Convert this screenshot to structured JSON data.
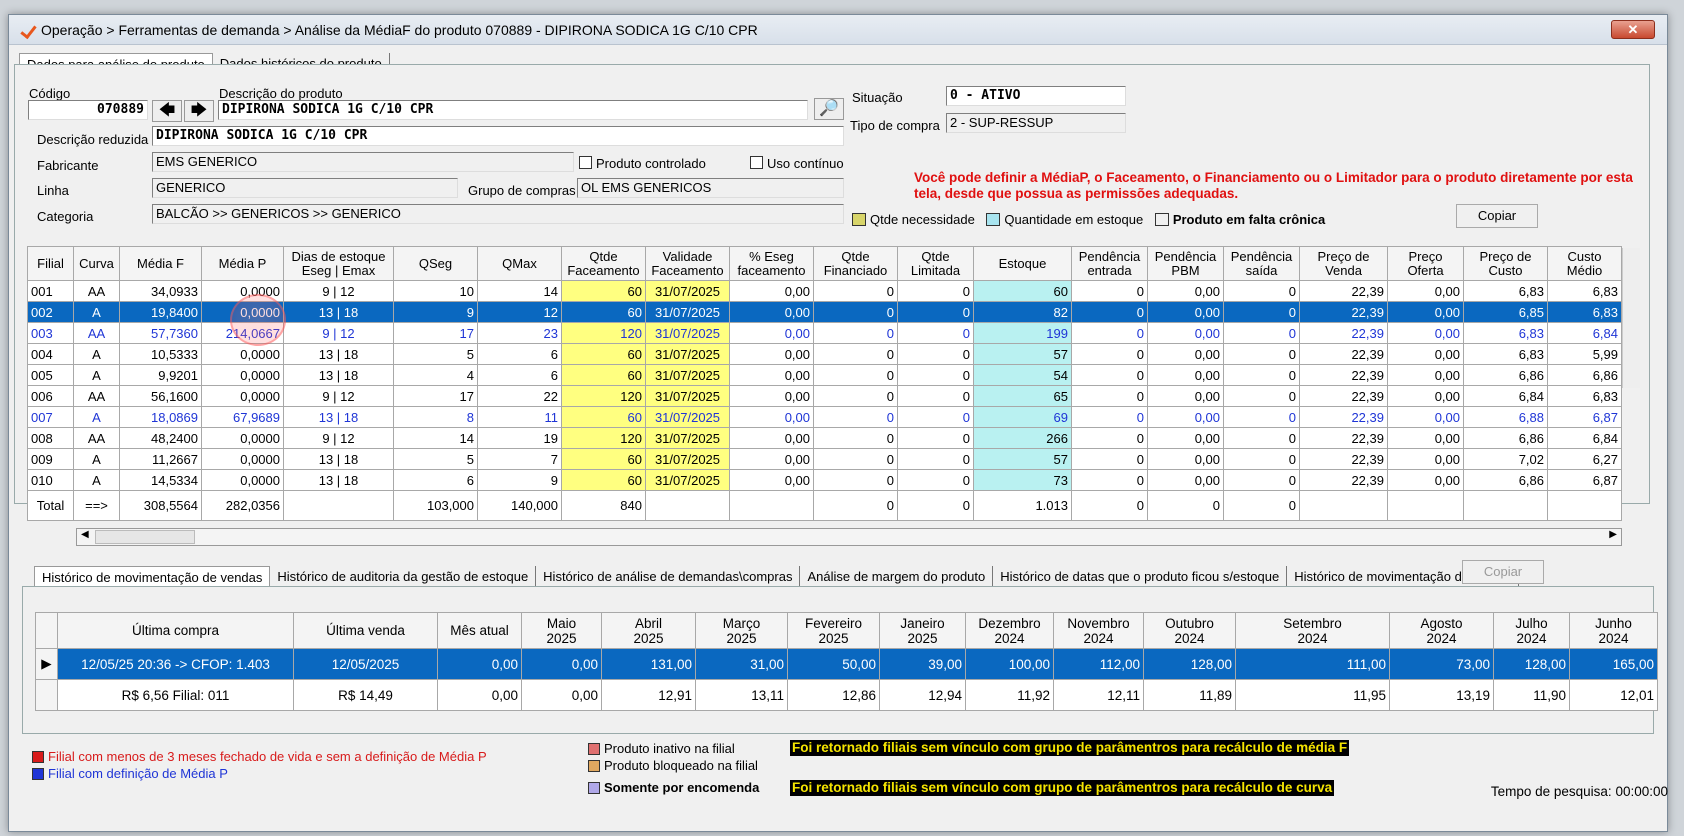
{
  "window": {
    "title": "Operação > Ferramentas de demanda > Análise da MédiaF do produto 070889 - DIPIRONA SODICA 1G C/10 CPR",
    "close": "✕"
  },
  "tabs": [
    "Dados para análise do produto",
    "Dados históricos do produto"
  ],
  "form": {
    "codigo_label": "Código",
    "codigo": "070889",
    "descricao_label": "Descrição do produto",
    "descricao": "DIPIRONA SODICA 1G C/10 CPR",
    "desc_reduzida_label": "Descrição reduzida",
    "desc_reduzida": "DIPIRONA SODICA 1G C/10 CPR",
    "fabricante_label": "Fabricante",
    "fabricante": "EMS GENERICO",
    "linha_label": "Linha",
    "linha": "GENERICO",
    "categoria_label": "Categoria",
    "categoria": "BALCÃO >> GENERICOS >> GENERICO",
    "grupo_label": "Grupo de compras",
    "grupo": "OL EMS GENERICOS",
    "controlado_label": "Produto controlado",
    "continuo_label": "Uso contínuo",
    "situacao_label": "Situação",
    "situacao": "0 - ATIVO",
    "tipo_label": "Tipo de compra",
    "tipo": "2 - SUP-RESSUP"
  },
  "warning": "Você pode definir a MédiaP, o Faceamento, o Financiamento ou o Limitador para o produto diretamente por esta tela, desde que possua as permissões adequadas.",
  "legend_top": {
    "necessidade": "Qtde necessidade",
    "estoque": "Quantidade em estoque",
    "falta": "Produto em falta crônica",
    "copiar": "Copiar"
  },
  "grid": {
    "headers": [
      "Filial",
      "Curva",
      "Média F",
      "Média P",
      "Dias de estoque|Eseg | Emax",
      "QSeg",
      "QMax",
      "Qtde|Faceamento",
      "Validade|Faceamento",
      "% Eseg|faceamento",
      "Qtde|Financiado",
      "Qtde|Limitada",
      "Estoque",
      "Pendência|entrada",
      "Pendência|PBM",
      "Pendência|saída",
      "Preço de|Venda",
      "Preço|Oferta",
      "Preço de|Custo",
      "Custo|Médio"
    ],
    "rows": [
      [
        "001",
        "AA",
        "34,0933",
        "0,0000",
        "9   |   12",
        "10",
        "14",
        "60",
        "31/07/2025",
        "0,00",
        "0",
        "0",
        "60",
        "0",
        "0,00",
        "0",
        "22,39",
        "0,00",
        "6,83",
        "6,83"
      ],
      [
        "002",
        "A",
        "19,8400",
        "0,0000",
        "13   |   18",
        "9",
        "12",
        "60",
        "31/07/2025",
        "0,00",
        "0",
        "0",
        "82",
        "0",
        "0,00",
        "0",
        "22,39",
        "0,00",
        "6,85",
        "6,83"
      ],
      [
        "003",
        "AA",
        "57,7360",
        "214,0667",
        "9   |   12",
        "17",
        "23",
        "120",
        "31/07/2025",
        "0,00",
        "0",
        "0",
        "199",
        "0",
        "0,00",
        "0",
        "22,39",
        "0,00",
        "6,83",
        "6,84"
      ],
      [
        "004",
        "A",
        "10,5333",
        "0,0000",
        "13   |   18",
        "5",
        "6",
        "60",
        "31/07/2025",
        "0,00",
        "0",
        "0",
        "57",
        "0",
        "0,00",
        "0",
        "22,39",
        "0,00",
        "6,83",
        "5,99"
      ],
      [
        "005",
        "A",
        "9,9201",
        "0,0000",
        "13   |   18",
        "4",
        "6",
        "60",
        "31/07/2025",
        "0,00",
        "0",
        "0",
        "54",
        "0",
        "0,00",
        "0",
        "22,39",
        "0,00",
        "6,86",
        "6,86"
      ],
      [
        "006",
        "AA",
        "56,1600",
        "0,0000",
        "9   |   12",
        "17",
        "22",
        "120",
        "31/07/2025",
        "0,00",
        "0",
        "0",
        "65",
        "0",
        "0,00",
        "0",
        "22,39",
        "0,00",
        "6,84",
        "6,83"
      ],
      [
        "007",
        "A",
        "18,0869",
        "67,9689",
        "13   |   18",
        "8",
        "11",
        "60",
        "31/07/2025",
        "0,00",
        "0",
        "0",
        "69",
        "0",
        "0,00",
        "0",
        "22,39",
        "0,00",
        "6,88",
        "6,87"
      ],
      [
        "008",
        "AA",
        "48,2400",
        "0,0000",
        "9   |   12",
        "14",
        "19",
        "120",
        "31/07/2025",
        "0,00",
        "0",
        "0",
        "266",
        "0",
        "0,00",
        "0",
        "22,39",
        "0,00",
        "6,86",
        "6,84"
      ],
      [
        "009",
        "A",
        "11,2667",
        "0,0000",
        "13   |   18",
        "5",
        "7",
        "60",
        "31/07/2025",
        "0,00",
        "0",
        "0",
        "57",
        "0",
        "0,00",
        "0",
        "22,39",
        "0,00",
        "7,02",
        "6,27"
      ],
      [
        "010",
        "A",
        "14,5334",
        "0,0000",
        "13   |   18",
        "6",
        "9",
        "60",
        "31/07/2025",
        "0,00",
        "0",
        "0",
        "73",
        "0",
        "0,00",
        "0",
        "22,39",
        "0,00",
        "6,86",
        "6,87"
      ]
    ],
    "blue_rows": [
      2,
      6
    ],
    "selected_row": 1,
    "total": [
      "Total",
      "==>",
      "308,5564",
      "282,0356",
      "",
      "103,000",
      "140,000",
      "840",
      "",
      "",
      "0",
      "0",
      "1.013",
      "0",
      "0",
      "0",
      "",
      "",
      "",
      ""
    ]
  },
  "bottom_tabs": [
    "Histórico de movimentação de vendas",
    "Histórico de auditoria da gestão de estoque",
    "Histórico de análise de demandas\\compras",
    "Análise de margem do produto",
    "Histórico de datas que o produto ficou s/estoque",
    "Histórico de movimentação de saídas"
  ],
  "bottom_copiar": "Copiar",
  "history": {
    "headers": [
      "Última compra",
      "Última venda",
      "Mês atual",
      "Maio|2025",
      "Abril|2025",
      "Março|2025",
      "Fevereiro|2025",
      "Janeiro|2025",
      "Dezembro|2024",
      "Novembro|2024",
      "Outubro|2024",
      "Setembro|2024",
      "Agosto|2024",
      "Julho|2024",
      "Junho|2024"
    ],
    "row1": [
      "12/05/25 20:36 -> CFOP: 1.403",
      "12/05/2025",
      "0,00",
      "0,00",
      "131,00",
      "31,00",
      "50,00",
      "39,00",
      "100,00",
      "112,00",
      "128,00",
      "111,00",
      "73,00",
      "128,00",
      "165,00"
    ],
    "row2": [
      "R$ 6,56 Filial: 011",
      "R$ 14,49",
      "0,00",
      "0,00",
      "12,91",
      "13,11",
      "12,86",
      "12,94",
      "11,92",
      "12,11",
      "11,89",
      "11,95",
      "13,19",
      "11,90",
      "12,01"
    ]
  },
  "legend_bottom": {
    "red": "Filial com menos de 3 meses fechado de vida e sem a definição de Média P",
    "blue": "Filial com definição de Média P",
    "inativo": "Produto inativo na filial",
    "bloqueado": "Produto bloqueado na filial",
    "encomenda": "Somente por encomenda",
    "msg1": "Foi retornado filiais sem vínculo com grupo de parâmentros para recálculo de média F",
    "msg2": "Foi retornado filiais sem vínculo com grupo de parâmentros para recálculo de curva"
  },
  "search_time": "Tempo de pesquisa: 00:00:00",
  "colors": {
    "selected": "#0a68c0",
    "blue_text": "#1f35d6",
    "yellow": "#ffff80",
    "cyan": "#b9f1f1",
    "warning": "#e01010"
  }
}
